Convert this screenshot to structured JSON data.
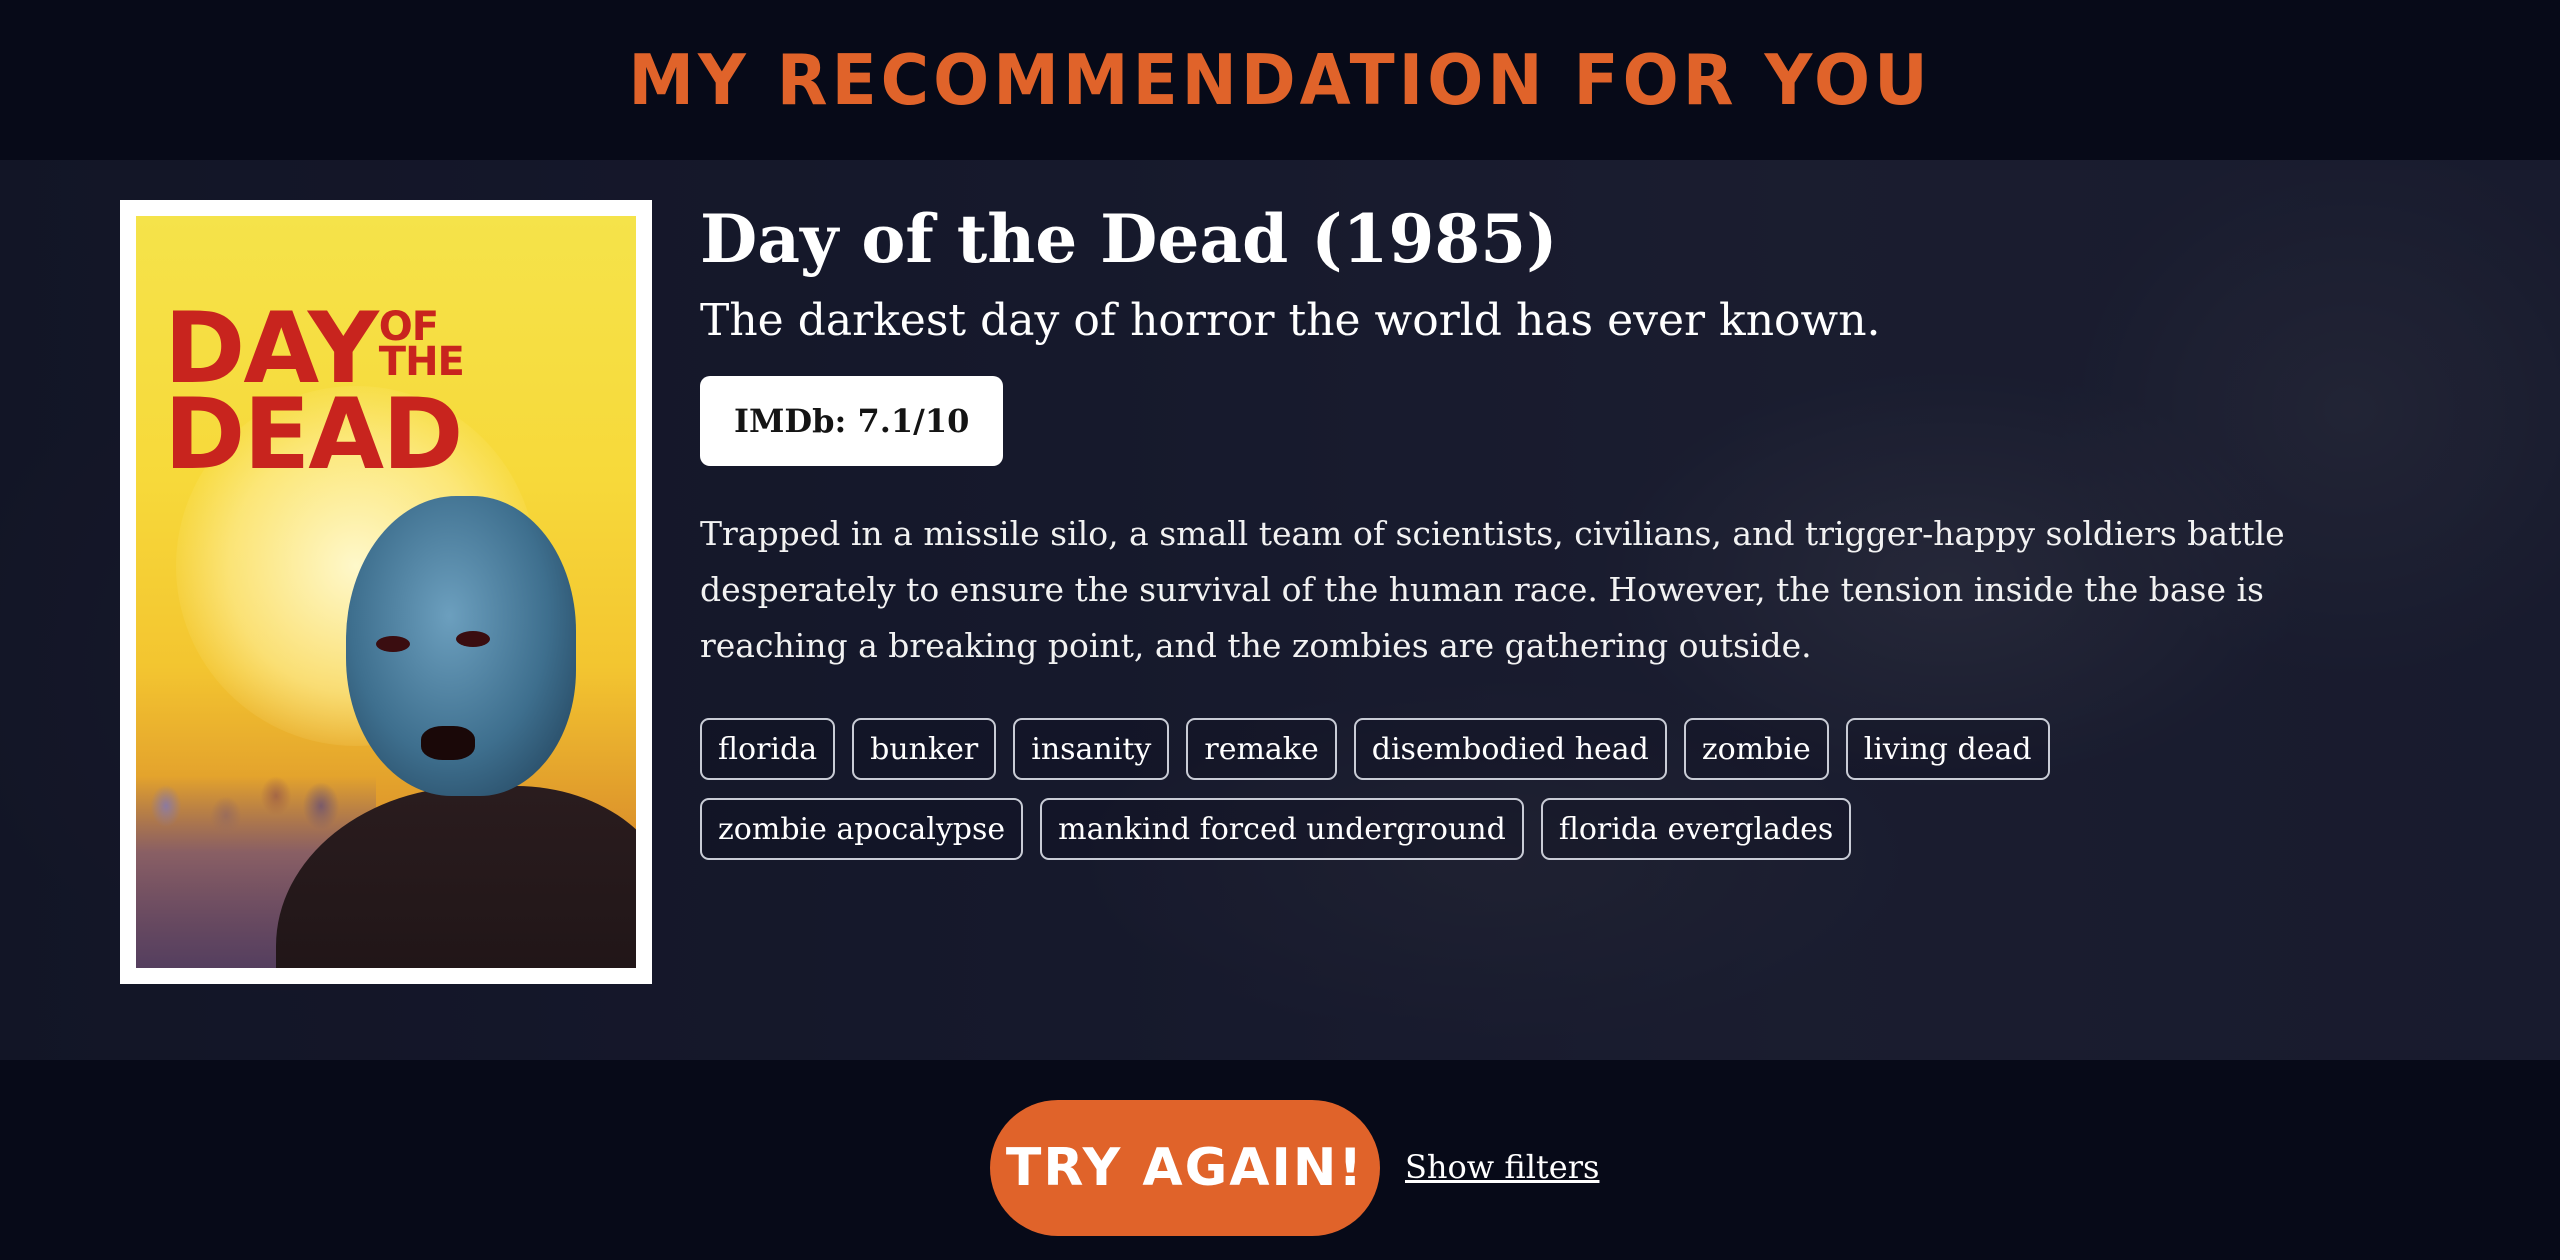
{
  "header": {
    "title": "MY RECOMMENDATION FOR YOU"
  },
  "movie": {
    "title": "Day of the Dead (1985)",
    "tagline": "The darkest day of horror the world has ever known.",
    "rating": "IMDb: 7.1/10",
    "overview": "Trapped in a missile silo, a small team of scientists, civilians, and trigger-happy soldiers battle desperately to ensure the survival of the human race. However, the tension inside the base is reaching a breaking point, and the zombies are gathering outside.",
    "poster": {
      "logo_line1": "DAY",
      "logo_of": "OF",
      "logo_the": "THE",
      "logo_line2": "DEAD"
    },
    "keywords": [
      "florida",
      "bunker",
      "insanity",
      "remake",
      "disembodied head",
      "zombie",
      "living dead",
      "zombie apocalypse",
      "mankind forced underground",
      "florida everglades"
    ]
  },
  "actions": {
    "try_again": "TRY AGAIN!",
    "show_filters": "Show filters"
  },
  "colors": {
    "accent": "#e0632a",
    "background": "#070a18"
  }
}
